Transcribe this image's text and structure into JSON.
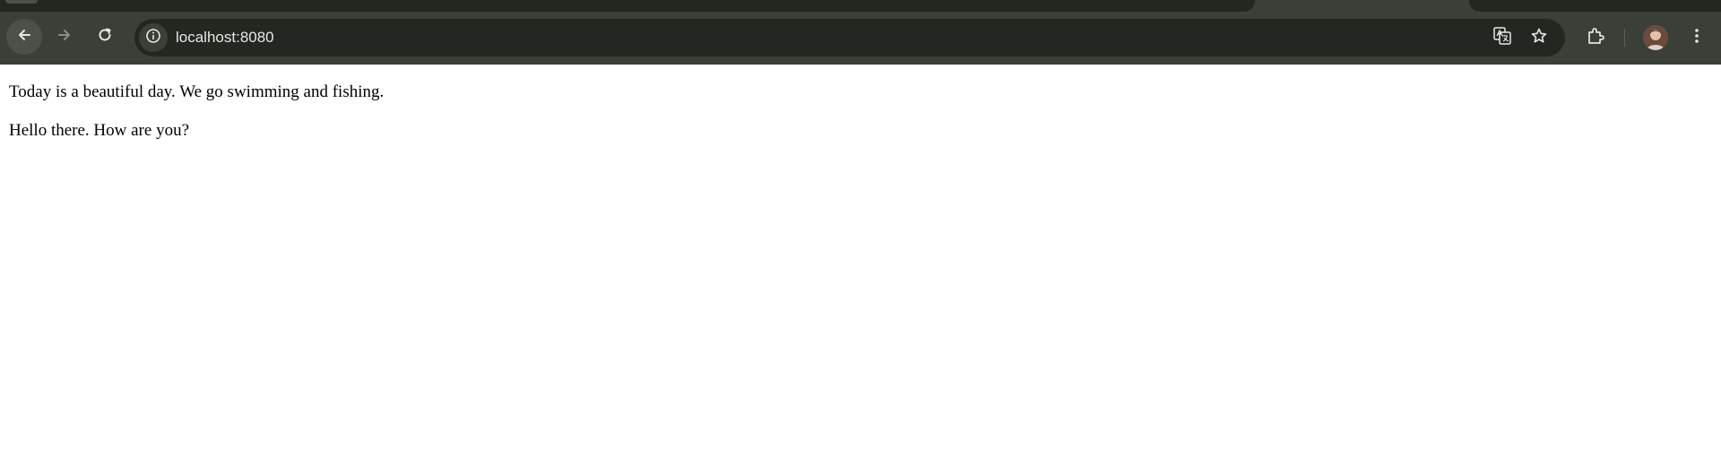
{
  "browser": {
    "address_bar": {
      "url": "localhost:8080"
    },
    "icons": {
      "back": "arrow-left-icon",
      "forward": "arrow-right-icon",
      "reload": "reload-icon",
      "site_info": "info-icon",
      "translate": "translate-icon",
      "bookmark": "star-icon",
      "extensions": "puzzle-icon",
      "profile": "avatar",
      "menu": "kebab-menu-icon"
    }
  },
  "page": {
    "paragraphs": [
      "Today is a beautiful day. We go swimming and fishing.",
      "Hello there. How are you?"
    ]
  }
}
